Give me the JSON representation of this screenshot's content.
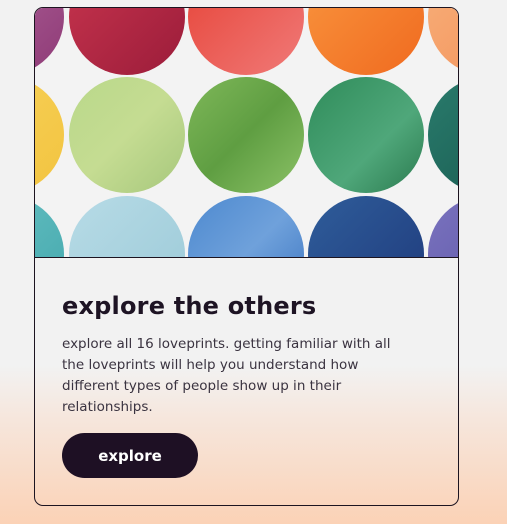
{
  "card": {
    "title": "explore the others",
    "description": "explore all 16 loveprints. getting familiar with all the loveprints will help you understand how different types of people show up in their relationships.",
    "button_label": "explore"
  },
  "colors": {
    "text_dark": "#1e1424",
    "button_bg": "#1e1024",
    "button_text": "#ffffff",
    "page_gradient_bottom": "#fbd2b6"
  },
  "hero_circles": [
    {
      "name": "magenta-circle",
      "gradient": "g-magenta"
    },
    {
      "name": "crimson-circle",
      "gradient": "g-crimson"
    },
    {
      "name": "red-circle",
      "gradient": "g-red"
    },
    {
      "name": "orange-circle",
      "gradient": "g-orange"
    },
    {
      "name": "peach-circle",
      "gradient": "g-peach"
    },
    {
      "name": "yellow-circle",
      "gradient": "g-yellow"
    },
    {
      "name": "lime-circle",
      "gradient": "g-lime"
    },
    {
      "name": "green-circle",
      "gradient": "g-green"
    },
    {
      "name": "emerald-circle",
      "gradient": "g-emerald"
    },
    {
      "name": "teal-circle",
      "gradient": "g-teal"
    },
    {
      "name": "cyan-circle",
      "gradient": "g-cyan"
    },
    {
      "name": "light-blue-circle",
      "gradient": "g-lightblue"
    },
    {
      "name": "blue-circle",
      "gradient": "g-blue"
    },
    {
      "name": "navy-circle",
      "gradient": "g-navy"
    },
    {
      "name": "indigo-circle",
      "gradient": "g-indigo"
    }
  ]
}
